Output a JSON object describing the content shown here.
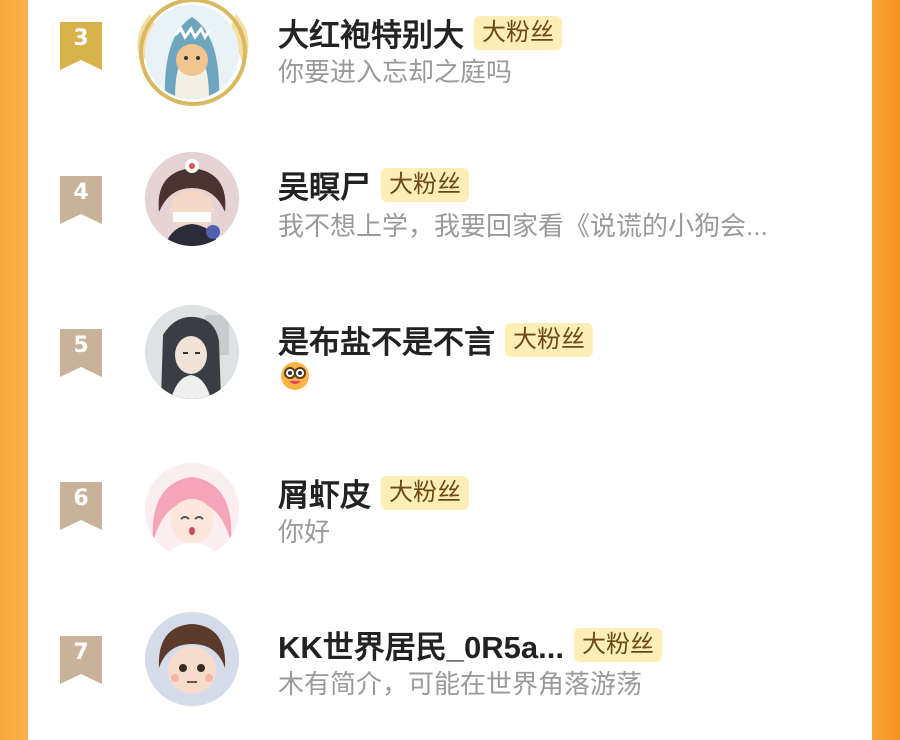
{
  "fans": [
    {
      "rank": "3",
      "name": "大红袍特别大",
      "badge": "大粉丝",
      "bio": "你要进入忘却之庭吗",
      "avatar": "shark-cat-avatar"
    },
    {
      "rank": "4",
      "name": "吴瞑尸",
      "badge": "大粉丝",
      "bio": "我不想上学，我要回家看《说谎的小狗会...",
      "avatar": "anime-boy-avatar"
    },
    {
      "rank": "5",
      "name": "是布盐不是不言",
      "badge": "大粉丝",
      "bio": "",
      "bio_icon": "nerd-face-emoji",
      "avatar": "long-hair-avatar"
    },
    {
      "rank": "6",
      "name": "屑虾皮",
      "badge": "大粉丝",
      "bio": "你好",
      "avatar": "pink-hair-avatar"
    },
    {
      "rank": "7",
      "name": "KK世界居民_0R5a...",
      "badge": "大粉丝",
      "bio": "木有简介，可能在世界角落游荡",
      "avatar": "chibi-boy-avatar"
    }
  ],
  "colors": {
    "rank3_gold": "#d8b24a",
    "rank_other": "#c8b29a",
    "badge_bg": "#fdeeb6",
    "border_orange": "#f7a133"
  }
}
